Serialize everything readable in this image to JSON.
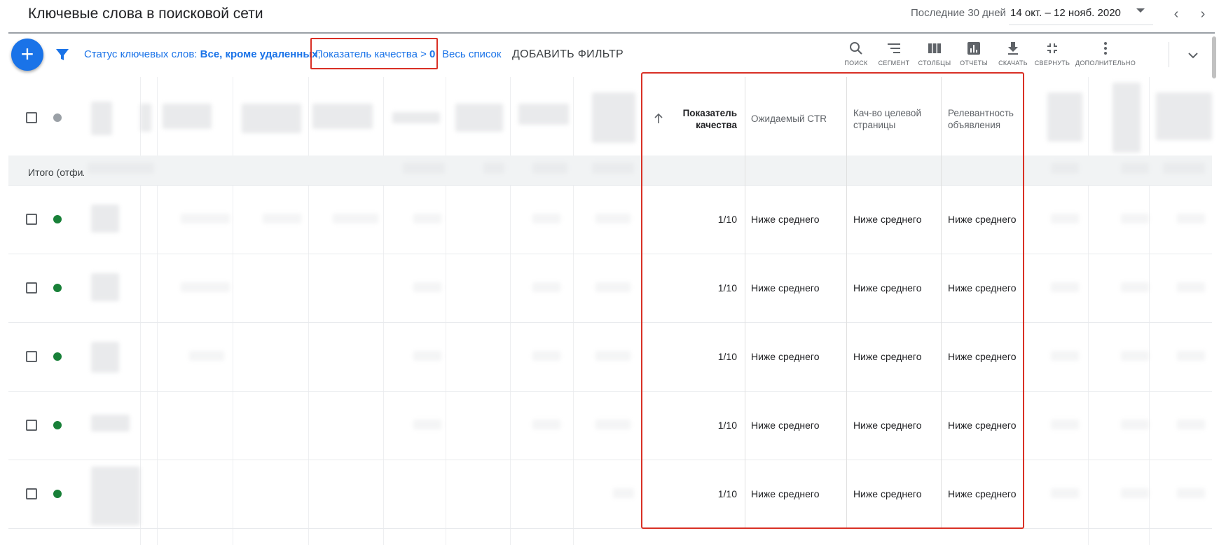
{
  "header": {
    "title": "Ключевые слова в поисковой сети",
    "date_range_label": "Последние 30 дней",
    "date_range_value": "14 окт. – 12 нояб. 2020"
  },
  "filter_bar": {
    "status_prefix": "Статус ключевых слов: ",
    "status_value": "Все, кроме удаленных",
    "separator": ";",
    "quality_filter_prefix": "Показатель качества > ",
    "quality_filter_value": "0",
    "full_list_link": "Весь список",
    "add_filter": "ДОБАВИТЬ ФИЛЬТР"
  },
  "toolbar": [
    {
      "label": "ПОИСК",
      "icon": "search-icon"
    },
    {
      "label": "СЕГМЕНТ",
      "icon": "segment-icon"
    },
    {
      "label": "СТОЛБЦЫ",
      "icon": "columns-icon"
    },
    {
      "label": "ОТЧЕТЫ",
      "icon": "reports-icon"
    },
    {
      "label": "СКАЧАТЬ",
      "icon": "download-icon"
    },
    {
      "label": "СВЕРНУТЬ",
      "icon": "collapse-icon"
    },
    {
      "label": "ДОПОЛНИТЕЛЬНО",
      "icon": "more-vert-icon"
    }
  ],
  "table": {
    "total_row_label": "Итого (отфильтровано)",
    "highlighted_columns": {
      "quality_score": "Показатель качества",
      "expected_ctr": "Ожидаемый CTR",
      "landing_page": "Кач-во целевой страницы",
      "ad_relevance": "Релевантность объявления"
    },
    "rows": [
      {
        "status": "enabled",
        "quality_score": "1/10",
        "expected_ctr": "Ниже среднего",
        "landing_page": "Ниже среднего",
        "ad_relevance": "Ниже среднего"
      },
      {
        "status": "enabled",
        "quality_score": "1/10",
        "expected_ctr": "Ниже среднего",
        "landing_page": "Ниже среднего",
        "ad_relevance": "Ниже среднего"
      },
      {
        "status": "enabled",
        "quality_score": "1/10",
        "expected_ctr": "Ниже среднего",
        "landing_page": "Ниже среднего",
        "ad_relevance": "Ниже среднего"
      },
      {
        "status": "enabled",
        "quality_score": "1/10",
        "expected_ctr": "Ниже среднего",
        "landing_page": "Ниже среднего",
        "ad_relevance": "Ниже среднего"
      },
      {
        "status": "enabled",
        "quality_score": "1/10",
        "expected_ctr": "Ниже среднего",
        "landing_page": "Ниже среднего",
        "ad_relevance": "Ниже среднего"
      }
    ]
  },
  "colors": {
    "accent": "#1a73e8",
    "highlight": "#d93025",
    "status_enabled": "#188038",
    "status_header": "#9aa0a6"
  }
}
